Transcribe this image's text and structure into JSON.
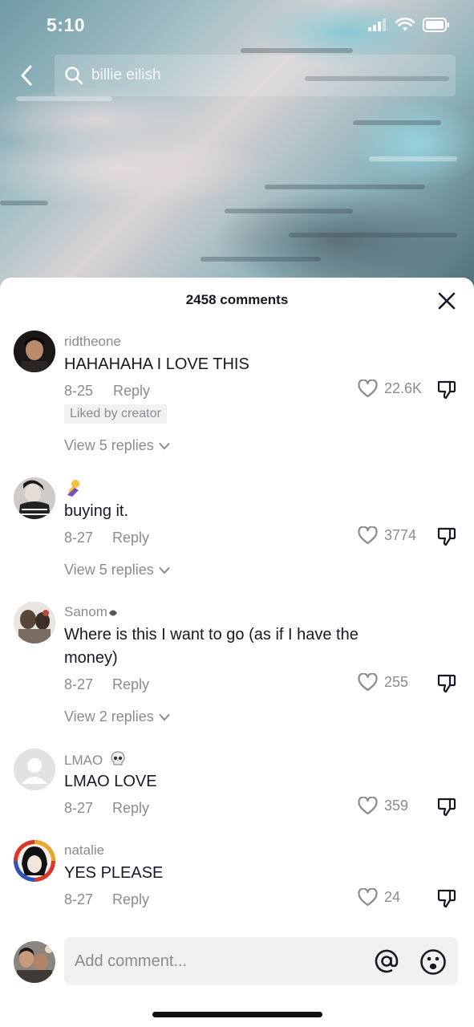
{
  "status_bar": {
    "time": "5:10"
  },
  "search": {
    "query": "billie eilish"
  },
  "comments_header": {
    "count_label": "2458 comments"
  },
  "comments": [
    {
      "username": "ridtheone",
      "text": "HAHAHAHA I LOVE THIS",
      "date": "8-25",
      "reply_label": "Reply",
      "likes": "22.6K",
      "badge": "Liked by creator",
      "view_replies": "View 5 replies"
    },
    {
      "username": "",
      "username_icon": "emoji-icon",
      "text": "buying it.",
      "date": "8-27",
      "reply_label": "Reply",
      "likes": "3774",
      "view_replies": "View 5 replies"
    },
    {
      "username": "Sanom",
      "text": "Where is this I want to go (as if I have the money)",
      "date": "8-27",
      "reply_label": "Reply",
      "likes": "255",
      "view_replies": "View 2 replies"
    },
    {
      "username": "LMAO",
      "username_suffix_icon": "skull-icon",
      "text": "LMAO LOVE",
      "date": "8-27",
      "reply_label": "Reply",
      "likes": "359"
    },
    {
      "username": "natalie",
      "text": "YES PLEASE",
      "date": "8-27",
      "reply_label": "Reply",
      "likes": "24"
    }
  ],
  "composer": {
    "placeholder": "Add comment..."
  },
  "colors": {
    "text_primary": "#161823",
    "text_secondary": "#8a8b91",
    "input_bg": "#f1f1f2"
  }
}
